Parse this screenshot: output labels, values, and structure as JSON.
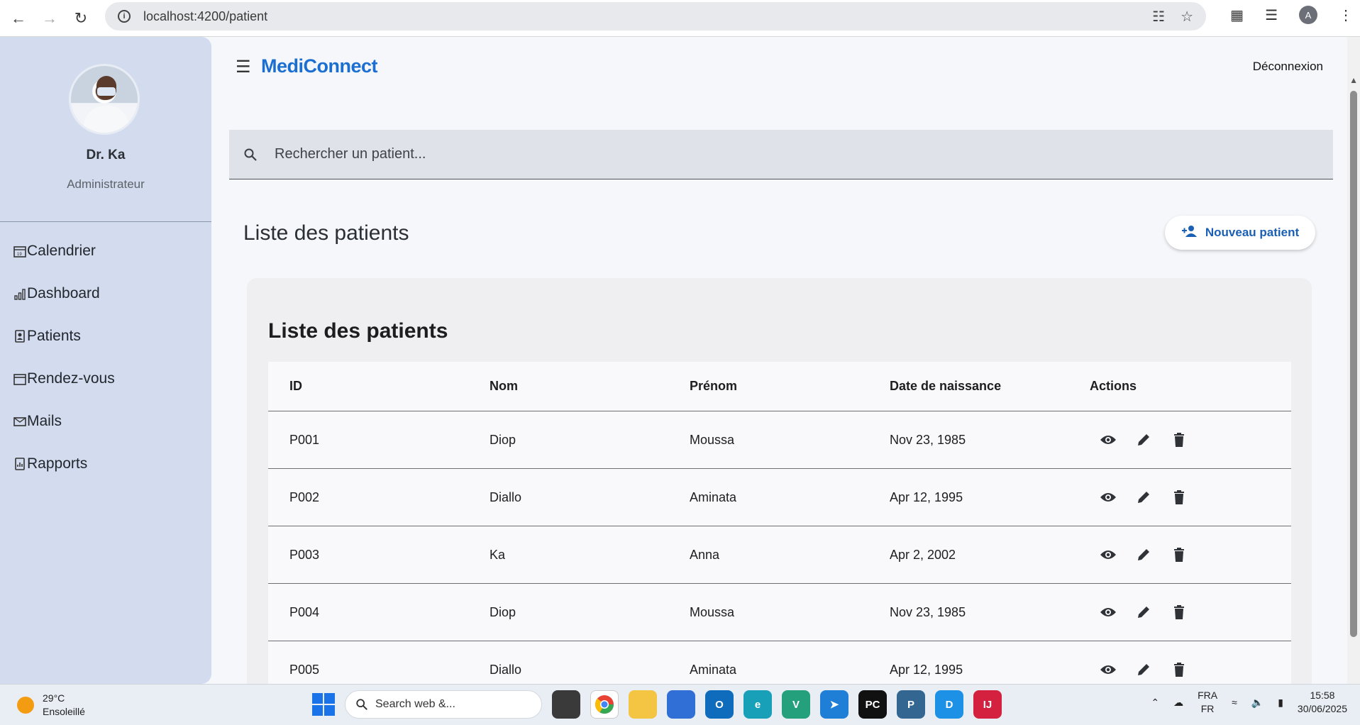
{
  "browser": {
    "url": "localhost:4200/patient",
    "profile_initial": "A"
  },
  "sidebar": {
    "doctor_name": "Dr. Ka",
    "doctor_role": "Administrateur",
    "items": [
      {
        "label": "Calendrier",
        "icon": "calendar-icon"
      },
      {
        "label": "Dashboard",
        "icon": "chart-icon"
      },
      {
        "label": "Patients",
        "icon": "patient-icon"
      },
      {
        "label": "Rendez-vous",
        "icon": "appointment-icon"
      },
      {
        "label": "Mails",
        "icon": "mail-icon"
      },
      {
        "label": "Rapports",
        "icon": "report-icon"
      }
    ]
  },
  "header": {
    "brand": "MediConnect",
    "logout": "Déconnexion"
  },
  "search": {
    "placeholder": "Rechercher un patient..."
  },
  "main": {
    "page_title": "Liste des patients",
    "new_patient_label": "Nouveau patient",
    "card_title": "Liste des patients",
    "columns": [
      "ID",
      "Nom",
      "Prénom",
      "Date de naissance",
      "Actions"
    ],
    "rows": [
      {
        "id": "P001",
        "nom": "Diop",
        "prenom": "Moussa",
        "date": "Nov 23, 1985"
      },
      {
        "id": "P002",
        "nom": "Diallo",
        "prenom": "Aminata",
        "date": "Apr 12, 1995"
      },
      {
        "id": "P003",
        "nom": "Ka",
        "prenom": "Anna",
        "date": "Apr 2, 2002"
      },
      {
        "id": "P004",
        "nom": "Diop",
        "prenom": "Moussa",
        "date": "Nov 23, 1985"
      },
      {
        "id": "P005",
        "nom": "Diallo",
        "prenom": "Aminata",
        "date": "Apr 12, 1995"
      }
    ]
  },
  "taskbar": {
    "temperature": "29°C",
    "weather": "Ensoleillé",
    "search_label": "Search web &...",
    "lang_top": "FRA",
    "lang_bottom": "FR",
    "time": "15:58",
    "date": "30/06/2025"
  },
  "colors": {
    "brand": "#1a6fd1",
    "sidebar_bg": "#d3dcee",
    "button_text": "#1a5fb4"
  }
}
